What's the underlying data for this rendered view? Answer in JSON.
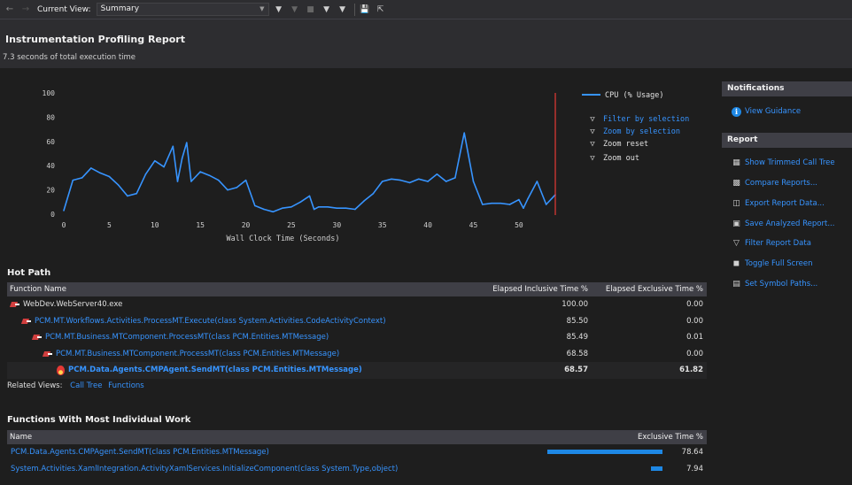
{
  "toolbar": {
    "back_icon": "arrow-left",
    "forward_icon": "arrow-right",
    "current_view_label": "Current View:",
    "current_view_value": "Summary",
    "icons": [
      "filter",
      "filter-disabled",
      "stop-square",
      "filter-by-selection",
      "zoom-by-selection",
      "save-disk",
      "export"
    ]
  },
  "report": {
    "title": "Instrumentation Profiling Report",
    "subtitle": "7.3 seconds of total execution time"
  },
  "chart_data": {
    "type": "line",
    "xlabel": "Wall Clock Time (Seconds)",
    "ylabel": "",
    "xlim": [
      0,
      54
    ],
    "ylim": [
      0,
      100
    ],
    "xticks": [
      0,
      5,
      10,
      15,
      20,
      25,
      30,
      35,
      40,
      45,
      50
    ],
    "yticks": [
      0,
      20,
      40,
      60,
      80,
      100
    ],
    "series": [
      {
        "name": "CPU (% Usage)",
        "color": "#3794ff",
        "x": [
          0,
          1,
          2,
          3,
          4,
          5,
          6,
          7,
          8,
          9,
          10,
          11,
          12,
          12.5,
          13,
          13.5,
          14,
          15,
          16,
          17,
          18,
          19,
          20,
          21,
          22,
          23,
          24,
          25,
          26,
          27,
          27.5,
          28,
          29,
          30,
          31,
          32,
          33,
          34,
          35,
          36,
          37,
          38,
          39,
          40,
          41,
          42,
          43,
          44,
          45,
          46,
          47,
          48,
          49,
          50,
          50.5,
          51,
          52,
          53,
          54
        ],
        "y": [
          3,
          28,
          30,
          38,
          34,
          31,
          24,
          15,
          17,
          33,
          44,
          39,
          56,
          27,
          46,
          59,
          27,
          35,
          32,
          28,
          20,
          22,
          28,
          7,
          4,
          2,
          5,
          6,
          10,
          15,
          4,
          6,
          6,
          5,
          5,
          4,
          11,
          17,
          27,
          29,
          28,
          26,
          29,
          27,
          33,
          27,
          30,
          67,
          27,
          8,
          9,
          9,
          8,
          12,
          5,
          13,
          27,
          8,
          16
        ]
      }
    ],
    "selection_marker_x": 54,
    "legend": "top-right"
  },
  "chart_actions": [
    {
      "label": "Filter by selection",
      "enabled": true,
      "icon": "filter-by-selection"
    },
    {
      "label": "Zoom by selection",
      "enabled": true,
      "icon": "funnel"
    },
    {
      "label": "Zoom reset",
      "enabled": false,
      "icon": "funnel"
    },
    {
      "label": "Zoom out",
      "enabled": false,
      "icon": "funnel"
    }
  ],
  "notifications": {
    "title": "Notifications",
    "items": [
      {
        "label": "View Guidance",
        "icon": "info-icon"
      }
    ]
  },
  "report_panel": {
    "title": "Report",
    "items": [
      {
        "label": "Show Trimmed Call Tree",
        "icon": "call-tree-icon"
      },
      {
        "label": "Compare Reports...",
        "icon": "compare-icon"
      },
      {
        "label": "Export Report Data...",
        "icon": "export-icon"
      },
      {
        "label": "Save Analyzed Report...",
        "icon": "save-icon"
      },
      {
        "label": "Filter Report Data",
        "icon": "filter-icon"
      },
      {
        "label": "Toggle Full Screen",
        "icon": "fullscreen-icon"
      },
      {
        "label": "Set Symbol Paths...",
        "icon": "symbol-paths-icon"
      }
    ]
  },
  "hot_path": {
    "title": "Hot Path",
    "columns": [
      "Function Name",
      "Elapsed Inclusive Time %",
      "Elapsed Exclusive Time %"
    ],
    "rows": [
      {
        "name": "WebDev.WebServer40.exe",
        "inclusive": "100.00",
        "exclusive": "0.00",
        "depth": 0,
        "link": false,
        "icon": "function-icon"
      },
      {
        "name": "PCM.MT.Workflows.Activities.ProcessMT.Execute(class System.Activities.CodeActivityContext)",
        "inclusive": "85.50",
        "exclusive": "0.00",
        "depth": 1,
        "link": true,
        "icon": "function-icon"
      },
      {
        "name": "PCM.MT.Business.MTComponent.ProcessMT(class PCM.Entities.MTMessage)",
        "inclusive": "85.49",
        "exclusive": "0.01",
        "depth": 2,
        "link": true,
        "icon": "function-icon"
      },
      {
        "name": "PCM.MT.Business.MTComponent.ProcessMT(class PCM.Entities.MTMessage)",
        "inclusive": "68.58",
        "exclusive": "0.00",
        "depth": 3,
        "link": true,
        "icon": "function-icon"
      },
      {
        "name": "PCM.Data.Agents.CMPAgent.SendMT(class PCM.Entities.MTMessage)",
        "inclusive": "68.57",
        "exclusive": "61.82",
        "depth": 4,
        "link": true,
        "bold": true,
        "icon": "hot-flame-icon"
      }
    ]
  },
  "related_views": {
    "label": "Related Views:",
    "links": [
      "Call Tree",
      "Functions"
    ]
  },
  "individual_work": {
    "title": "Functions With Most Individual Work",
    "columns": [
      "Name",
      "Exclusive Time %"
    ],
    "rows": [
      {
        "name": "PCM.Data.Agents.CMPAgent.SendMT(class PCM.Entities.MTMessage)",
        "value": "78.64",
        "fraction": 0.7864
      },
      {
        "name": "System.Activities.XamlIntegration.ActivityXamlServices.InitializeComponent(class System.Type,object)",
        "value": "7.94",
        "fraction": 0.0794
      }
    ]
  }
}
